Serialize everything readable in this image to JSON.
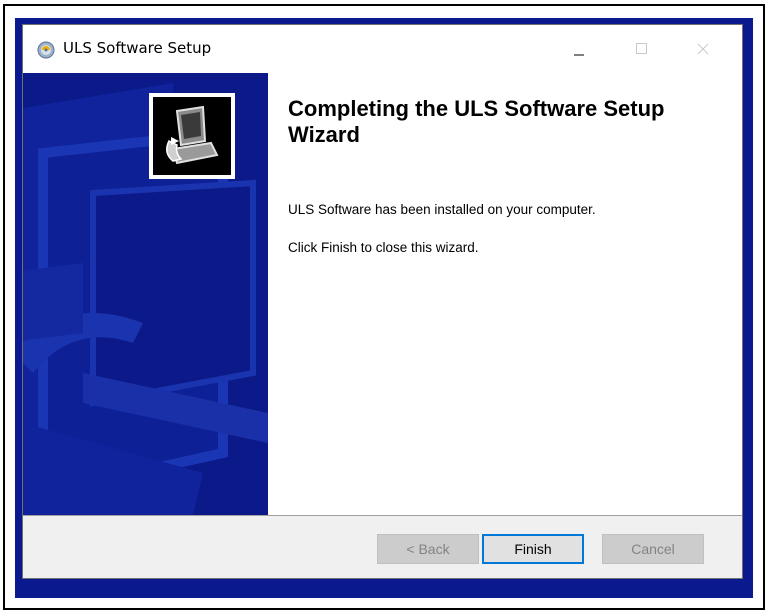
{
  "window": {
    "title": "ULS Software Setup",
    "controls": [
      "minimize-icon",
      "maximize-icon",
      "close-icon"
    ]
  },
  "content": {
    "heading": "Completing the ULS Software Setup Wizard",
    "paragraph1": "ULS Software has been installed on your computer.",
    "paragraph2": "Click Finish to close this wizard."
  },
  "buttons": {
    "back": {
      "label": "< Back",
      "enabled": false
    },
    "finish": {
      "label": "Finish",
      "enabled": true,
      "default": true
    },
    "cancel": {
      "label": "Cancel",
      "enabled": false
    }
  },
  "colors": {
    "desktop": "#0a1a8e",
    "side_panel": "#0b1a88",
    "default_button_border": "#0078d7"
  }
}
